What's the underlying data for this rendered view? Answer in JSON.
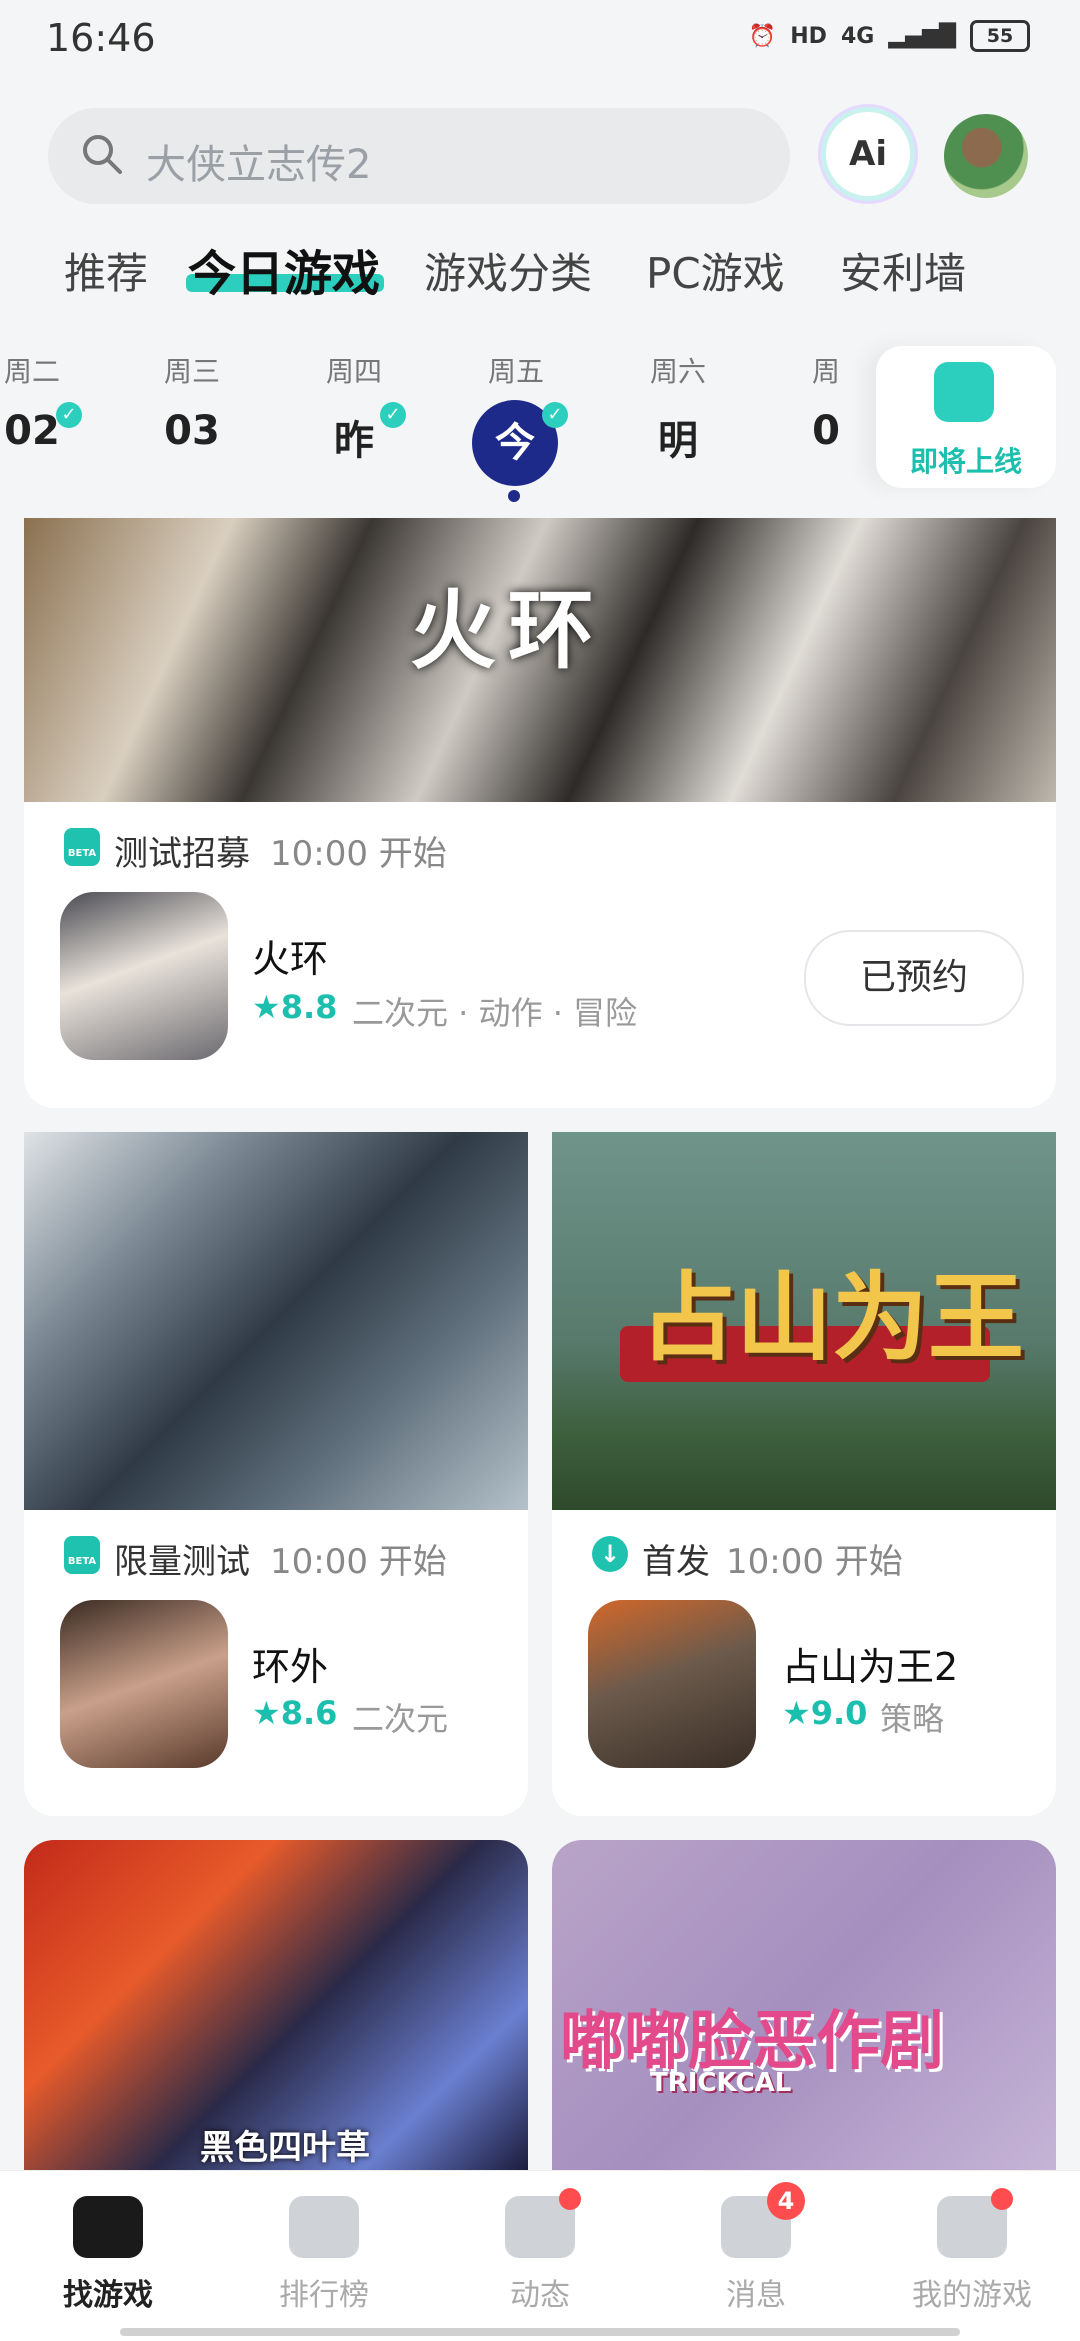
{
  "status_bar": {
    "time": "16:46",
    "network": "4G",
    "hd": "HD",
    "battery": "55"
  },
  "search": {
    "placeholder": "大侠立志传2",
    "ai_label": "Ai"
  },
  "tabs": [
    {
      "label": "推荐"
    },
    {
      "label": "今日游戏"
    },
    {
      "label": "游戏分类"
    },
    {
      "label": "PC游戏"
    },
    {
      "label": "安利墙"
    }
  ],
  "days": [
    {
      "weekday": "周二",
      "num": "02"
    },
    {
      "weekday": "周三",
      "num": "03"
    },
    {
      "weekday": "周四",
      "num": "昨"
    },
    {
      "weekday": "周五",
      "num": "今"
    },
    {
      "weekday": "周六",
      "num": "明"
    },
    {
      "weekday": "周",
      "num": "0"
    }
  ],
  "upcoming_label": "即将上线",
  "cards": [
    {
      "banner_title": "火环",
      "badge": "BETA",
      "event_type": "测试招募",
      "time": "10:00 开始",
      "name": "火环",
      "rating": "8.8",
      "tags": "二次元 · 动作 · 冒险",
      "action": "已预约",
      "accent": "#1cbfae"
    },
    {
      "badge": "BETA",
      "event_type": "限量测试",
      "time": "10:00 开始",
      "name": "环外",
      "rating": "8.6",
      "tags": "二次元"
    },
    {
      "banner_title": "占山为王",
      "badge": "↓",
      "event_type": "首发",
      "time": "10:00 开始",
      "name": "占山为王2",
      "rating": "9.0",
      "tags": "策略"
    }
  ],
  "bottom_banners": [
    {
      "title": "黑色四叶草"
    },
    {
      "title": "嘟嘟脸恶作剧",
      "subtitle": "TRICKCAL"
    }
  ],
  "bottom_nav": [
    {
      "label": "找游戏",
      "active": true
    },
    {
      "label": "排行榜"
    },
    {
      "label": "动态"
    },
    {
      "label": "消息",
      "badge": "4"
    },
    {
      "label": "我的游戏"
    }
  ]
}
